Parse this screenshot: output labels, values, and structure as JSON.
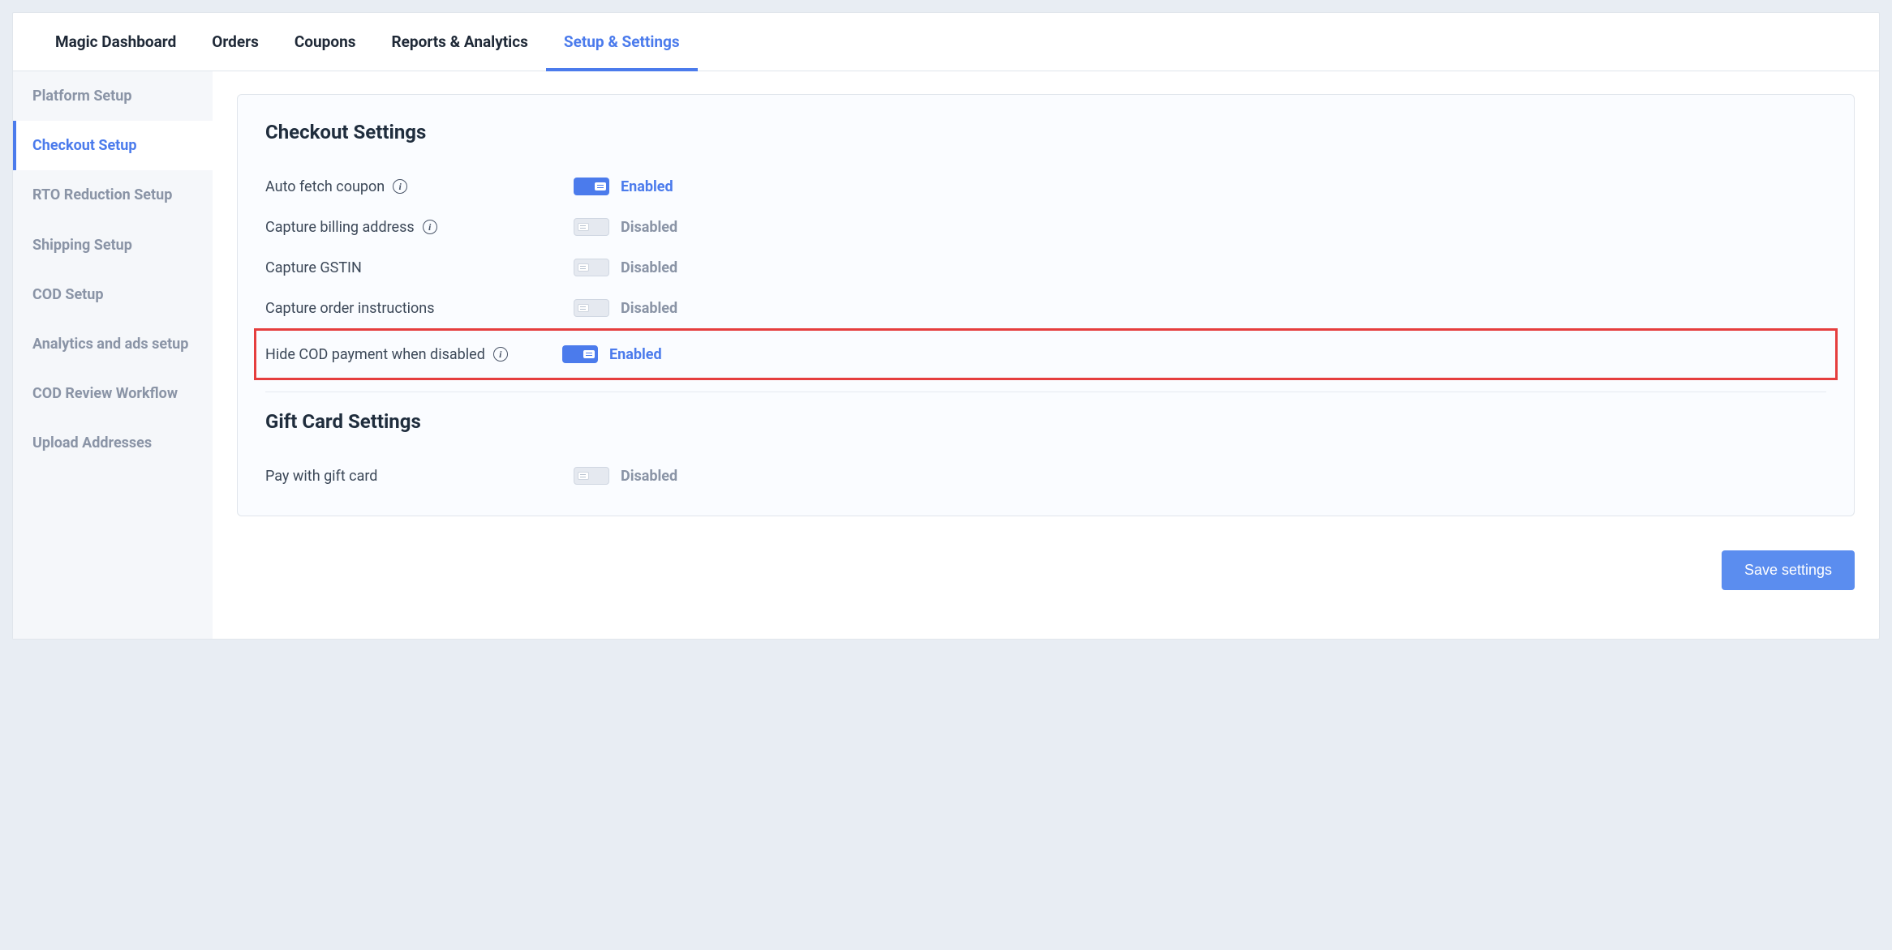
{
  "topTabs": {
    "items": [
      {
        "label": "Magic Dashboard"
      },
      {
        "label": "Orders"
      },
      {
        "label": "Coupons"
      },
      {
        "label": "Reports & Analytics"
      },
      {
        "label": "Setup & Settings"
      }
    ]
  },
  "sidebar": {
    "items": [
      {
        "label": "Platform Setup"
      },
      {
        "label": "Checkout Setup"
      },
      {
        "label": "RTO Reduction Setup"
      },
      {
        "label": "Shipping Setup"
      },
      {
        "label": "COD Setup"
      },
      {
        "label": "Analytics and ads setup"
      },
      {
        "label": "COD Review Workflow"
      },
      {
        "label": "Upload Addresses"
      }
    ]
  },
  "sections": {
    "checkout": {
      "title": "Checkout Settings",
      "rows": {
        "autoFetchCoupon": {
          "label": "Auto fetch coupon",
          "status": "Enabled"
        },
        "captureBilling": {
          "label": "Capture billing address",
          "status": "Disabled"
        },
        "captureGstin": {
          "label": "Capture GSTIN",
          "status": "Disabled"
        },
        "captureInstructions": {
          "label": "Capture order instructions",
          "status": "Disabled"
        },
        "hideCod": {
          "label": "Hide COD payment when disabled",
          "status": "Enabled"
        }
      }
    },
    "giftCard": {
      "title": "Gift Card Settings",
      "rows": {
        "payWithGiftCard": {
          "label": "Pay with gift card",
          "status": "Disabled"
        }
      }
    }
  },
  "footer": {
    "saveLabel": "Save settings"
  }
}
